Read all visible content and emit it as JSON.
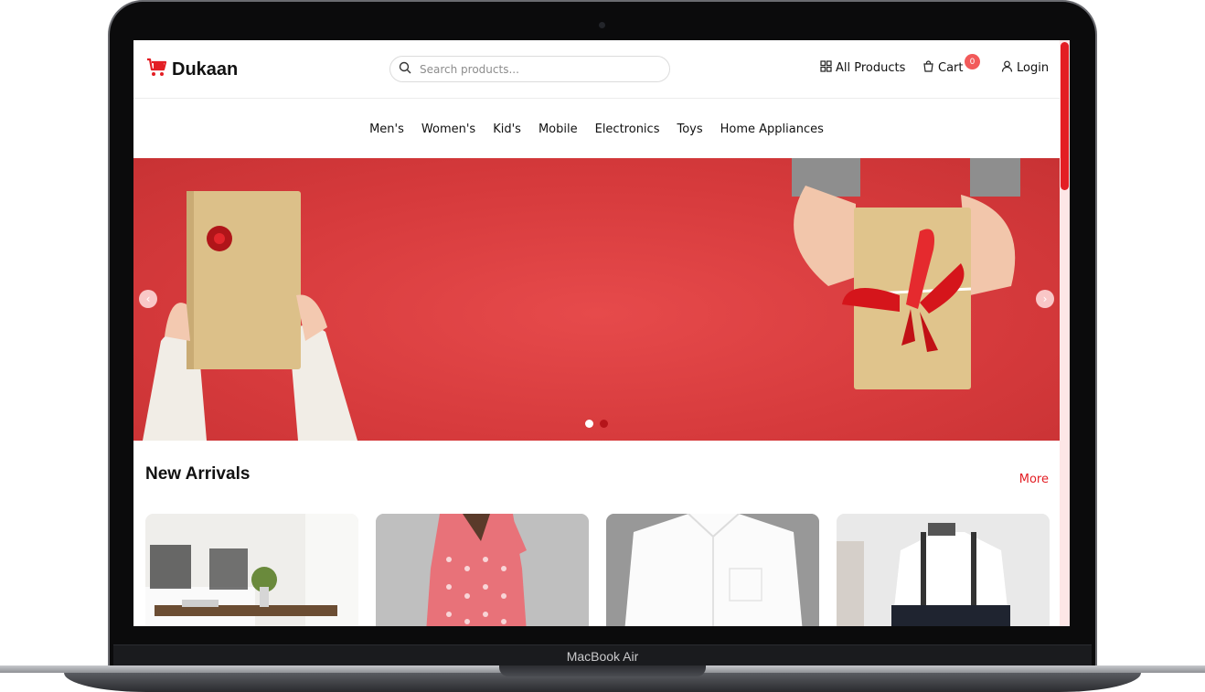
{
  "header": {
    "logo_text": "Dukaan",
    "search_placeholder": "Search products...",
    "all_products_label": "All Products",
    "cart_label": "Cart",
    "cart_count": "0",
    "login_label": "Login"
  },
  "categories": [
    "Men's",
    "Women's",
    "Kid's",
    "Mobile",
    "Electronics",
    "Toys",
    "Home Appliances"
  ],
  "hero": {
    "slide_count": 2,
    "active_slide": 1
  },
  "new_arrivals": {
    "title": "New Arrivals",
    "more_label": "More"
  },
  "device": {
    "label": "MacBook Air"
  },
  "colors": {
    "accent": "#e31e24",
    "hero_bg": "#d63a3c",
    "badge": "#f25a5a"
  },
  "icons": [
    "cart-logo-icon",
    "search-icon",
    "grid-icon",
    "bag-icon",
    "user-icon",
    "chevron-left-icon",
    "chevron-right-icon"
  ]
}
